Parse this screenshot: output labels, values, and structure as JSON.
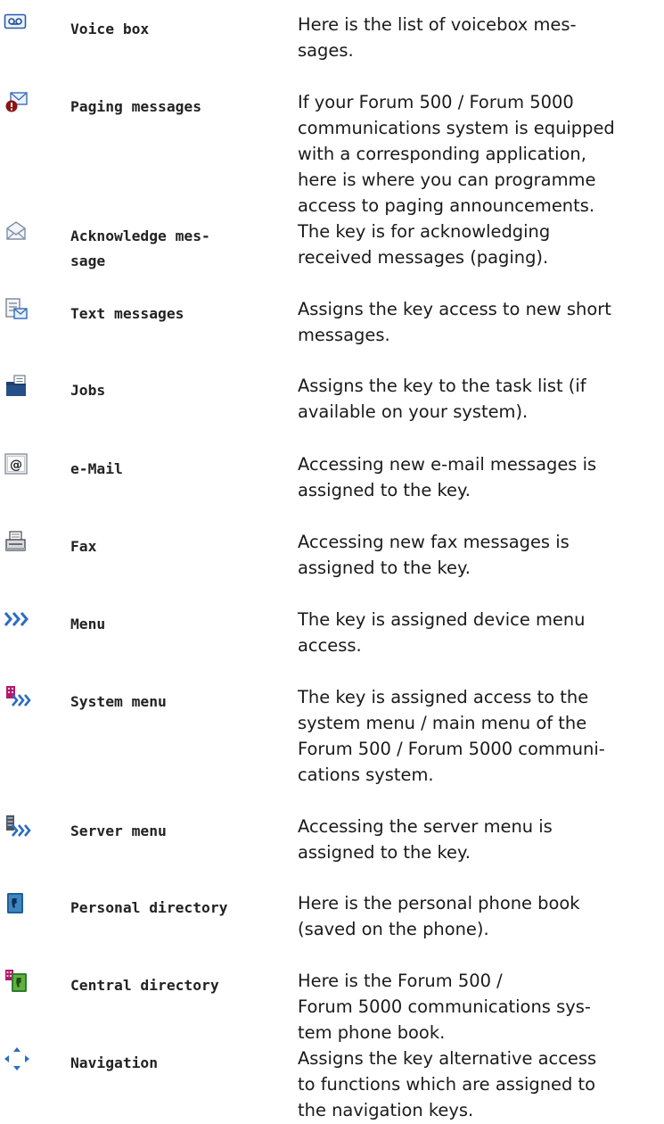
{
  "rows": [
    {
      "icon": "voicemail-icon",
      "label": "Voice box",
      "desc": "Here is the list of voicebox mes-\nsages."
    },
    {
      "icon": "paging-message-icon",
      "label": "Paging messages",
      "desc": "If your Forum 500 / Forum 5000\ncommunications system is equipped\nwith a corresponding application,\nhere is where you can programme\naccess to paging announcements."
    },
    {
      "icon": "acknowledge-envelope-icon",
      "label": "Acknowledge mes-\nsage",
      "desc": "The key is for acknowledging\nreceived messages (paging)."
    },
    {
      "icon": "text-message-icon",
      "label": "Text messages",
      "desc": "Assigns the key access to new short\nmessages."
    },
    {
      "icon": "jobs-folder-icon",
      "label": "Jobs",
      "desc": "Assigns the key to the task list (if\navailable on your system)."
    },
    {
      "icon": "email-at-icon",
      "label": "e-Mail",
      "desc": "Accessing new e-mail messages is\nassigned to the key."
    },
    {
      "icon": "fax-icon",
      "label": "Fax",
      "desc": "Accessing new fax messages is\nassigned to the key."
    },
    {
      "icon": "menu-arrows-icon",
      "label": "Menu",
      "desc": "The key is assigned device menu\naccess."
    },
    {
      "icon": "system-menu-icon",
      "label": "System menu",
      "desc": "The key is assigned access to the\nsystem menu / main menu of the\nForum 500 / Forum 5000 communi-\ncations system."
    },
    {
      "icon": "server-menu-icon",
      "label": "Server menu",
      "desc": "Accessing the server menu is\nassigned to the key."
    },
    {
      "icon": "personal-directory-icon",
      "label": "Personal directory",
      "desc": "Here is the personal phone book\n(saved on the phone)."
    },
    {
      "icon": "central-directory-icon",
      "label": "Central directory",
      "desc": "Here is the Forum 500 /\nForum 5000 communications sys-\ntem phone book."
    },
    {
      "icon": "navigation-icon",
      "label": "Navigation",
      "desc": "Assigns the key alternative access\nto functions which are assigned to\nthe navigation keys."
    }
  ]
}
